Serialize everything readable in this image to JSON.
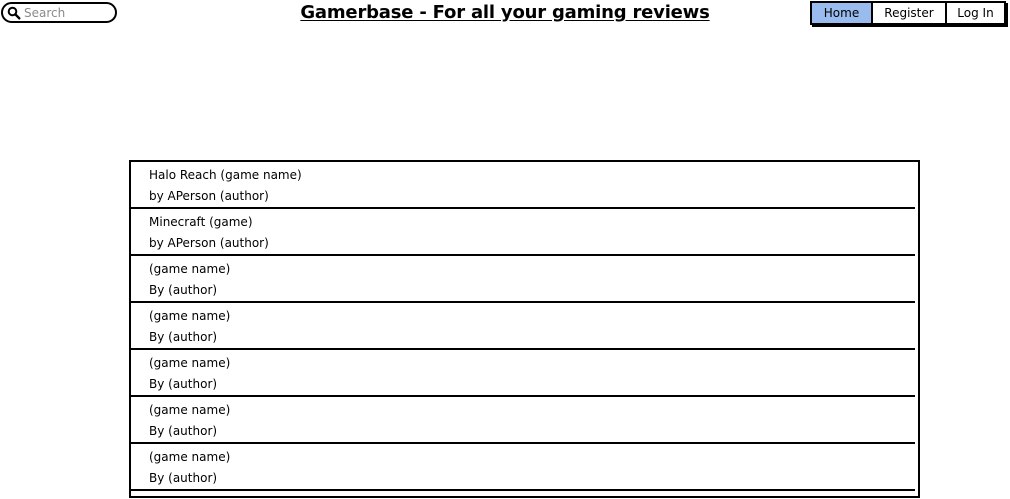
{
  "search": {
    "placeholder": "Search",
    "icon": "search-icon"
  },
  "header": {
    "title": "Gamerbase - For all your gaming reviews"
  },
  "nav": {
    "home": "Home",
    "register": "Register",
    "login": "Log In",
    "active_color": "#99bbee"
  },
  "reviews": [
    {
      "game": "Halo Reach (game name)",
      "author": "by APerson (author)"
    },
    {
      "game": "Minecraft (game)",
      "author": "by APerson (author)"
    },
    {
      "game": "(game name)",
      "author": "By (author)"
    },
    {
      "game": "(game name)",
      "author": "By (author)"
    },
    {
      "game": "(game name)",
      "author": "By (author)"
    },
    {
      "game": "(game name)",
      "author": "By (author)"
    },
    {
      "game": "(game name)",
      "author": "By (author)"
    }
  ]
}
